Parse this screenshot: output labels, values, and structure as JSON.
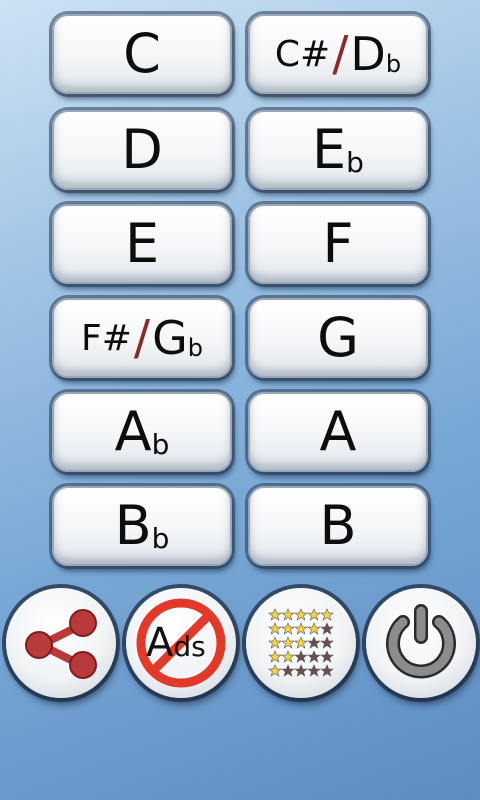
{
  "keys": [
    {
      "id": "c",
      "main": "C"
    },
    {
      "id": "csharp-dflat",
      "left": "C#",
      "sep": "/",
      "right": "D",
      "sub": "b"
    },
    {
      "id": "d",
      "main": "D"
    },
    {
      "id": "eflat",
      "main": "E",
      "sub": "b"
    },
    {
      "id": "e",
      "main": "E"
    },
    {
      "id": "f",
      "main": "F"
    },
    {
      "id": "fsharp-gflat",
      "left": "F#",
      "sep": "/",
      "right": "G",
      "sub": "b"
    },
    {
      "id": "g",
      "main": "G"
    },
    {
      "id": "aflat",
      "main": "A",
      "sub": "b"
    },
    {
      "id": "a",
      "main": "A"
    },
    {
      "id": "bflat",
      "main": "B",
      "sub": "b"
    },
    {
      "id": "b",
      "main": "B"
    }
  ],
  "toolbar": {
    "share_icon": "share-icon",
    "no_ads_icon": "no-ads-icon",
    "no_ads_text_a": "A",
    "no_ads_text_ds": "ds",
    "rate_icon": "rating-stars-icon",
    "power_icon": "power-icon"
  },
  "colors": {
    "accent_red": "#b83a3a",
    "star_gold": "#f2d34a",
    "star_dark": "#6b4e4e",
    "power_gray": "#8a8c8e"
  }
}
